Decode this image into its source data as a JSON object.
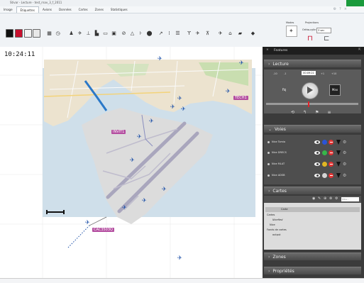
{
  "window": {
    "title": "Stivar - Lecture - test_rnav_3_f_2011"
  },
  "tabs": [
    "Image",
    "Étiquettes",
    "Avions",
    "Données",
    "Cartes",
    "Zones",
    "Statistiques"
  ],
  "ribbon": {
    "group_modes": "Modes",
    "group_projections": "Projections",
    "projection_label": "Ortho-cylin",
    "projection_value": "3 sec"
  },
  "map": {
    "clock": "10:24:11",
    "labels": {
      "tech": "TECH1",
      "invit": "INVIT1",
      "caq": "CAC3503Q"
    }
  },
  "panel": {
    "title": "Features",
    "lecture": {
      "title": "Lecture",
      "step_back2": "-10",
      "step_back1": "-1",
      "rate": "00:09:21",
      "step_fwd1": "+1",
      "step_fwd2": "+10",
      "fq_label": "fq",
      "max_label": "Max"
    },
    "voies": {
      "title": "Voies",
      "rows": [
        {
          "name": "Nice Tomia",
          "color": "#2b54d6"
        },
        {
          "name": "Nice DRECS",
          "color": "#37b64a"
        },
        {
          "name": "Nice MLAT",
          "color": "#e0b623"
        },
        {
          "name": "Nice ADSB",
          "color": "#d4d4d4"
        }
      ]
    },
    "cartes": {
      "title": "Cartes",
      "search_placeholder": "filtre...",
      "col_carte": "Carte",
      "layers": [
        "Cartes",
        "Nicefied",
        "Nice",
        "Fonds de cartes",
        "output"
      ]
    },
    "zones": {
      "title": "Zones"
    },
    "proprietes": {
      "title": "Propriétés"
    }
  },
  "colors": {
    "swatch_black": "#111111",
    "swatch_red": "#c8102e",
    "accent_green": "#1a9a3c",
    "label_pink": "#b44ea0"
  }
}
